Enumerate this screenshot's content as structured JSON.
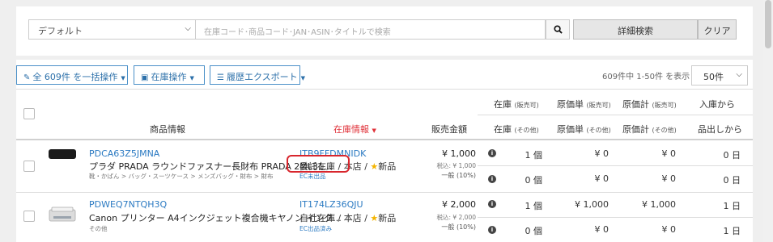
{
  "filter": {
    "preset": "デフォルト",
    "search_placeholder": "在庫コード･商品コード･JAN･ASIN･タイトルで検索",
    "detail_search": "詳細検索",
    "clear": "クリア"
  },
  "toolbar": {
    "bulk": "全 609件 を一括操作",
    "stock_ops": "在庫操作",
    "history_export": "履歴エクスポート",
    "count_text": "609件中 1-50件 を表示",
    "per_page": "50件"
  },
  "headers": {
    "product_info": "商品情報",
    "stock_info": "在庫情報",
    "sale_price": "販売金額",
    "stock": "在庫",
    "sellable": "(販売可)",
    "others": "(その他)",
    "unit_cost": "原価単",
    "total_cost": "原価計",
    "inbound_from": "入庫から",
    "since_shipping": "品出しから"
  },
  "rows": [
    {
      "sku": "PDCA63Z5JMNA",
      "name": "プラダ PRADA ラウンドファスナー長財布 PRADA 2ML31...",
      "category": "靴・かばん > バッグ・スーツケース > メンズバッグ・財布 > 財布",
      "stock_code": "ITB9FFDMNIDK",
      "stock_type": "委託在庫",
      "store": "本店",
      "condition": "新品",
      "ec_status": "EC未出品",
      "price": "¥ 1,000",
      "tax_in": "税込: ¥ 1,000",
      "general": "一般 (10%)",
      "qty_sellable": "1 個",
      "qty_other": "0 個",
      "unit_sellable": "¥ 0",
      "unit_other": "¥ 0",
      "total_sellable": "¥ 0",
      "total_other": "¥ 0",
      "days_in": "0 日",
      "days_ship": "0 日"
    },
    {
      "sku": "PDWEQ7NTQH3Q",
      "name": "Canon プリンター A4インクジェット複合機キヤノン インク...",
      "category": "その他",
      "stock_code": "IT174LZ36QJU",
      "stock_type": "自社在庫",
      "store": "本店",
      "condition": "新品",
      "ec_status": "EC出品済み",
      "price": "¥ 2,000",
      "tax_in": "税込: ¥ 2,000",
      "general": "一般 (10%)",
      "qty_sellable": "1 個",
      "qty_other": "0 個",
      "unit_sellable": "¥ 1,000",
      "unit_other": "¥ 0",
      "total_sellable": "¥ 1,000",
      "total_other": "¥ 0",
      "days_in": "1 日",
      "days_ship": "1 日"
    }
  ],
  "colors": {
    "link": "#2b7ac2",
    "accent_red": "#e0323a",
    "star": "#f4b400"
  }
}
